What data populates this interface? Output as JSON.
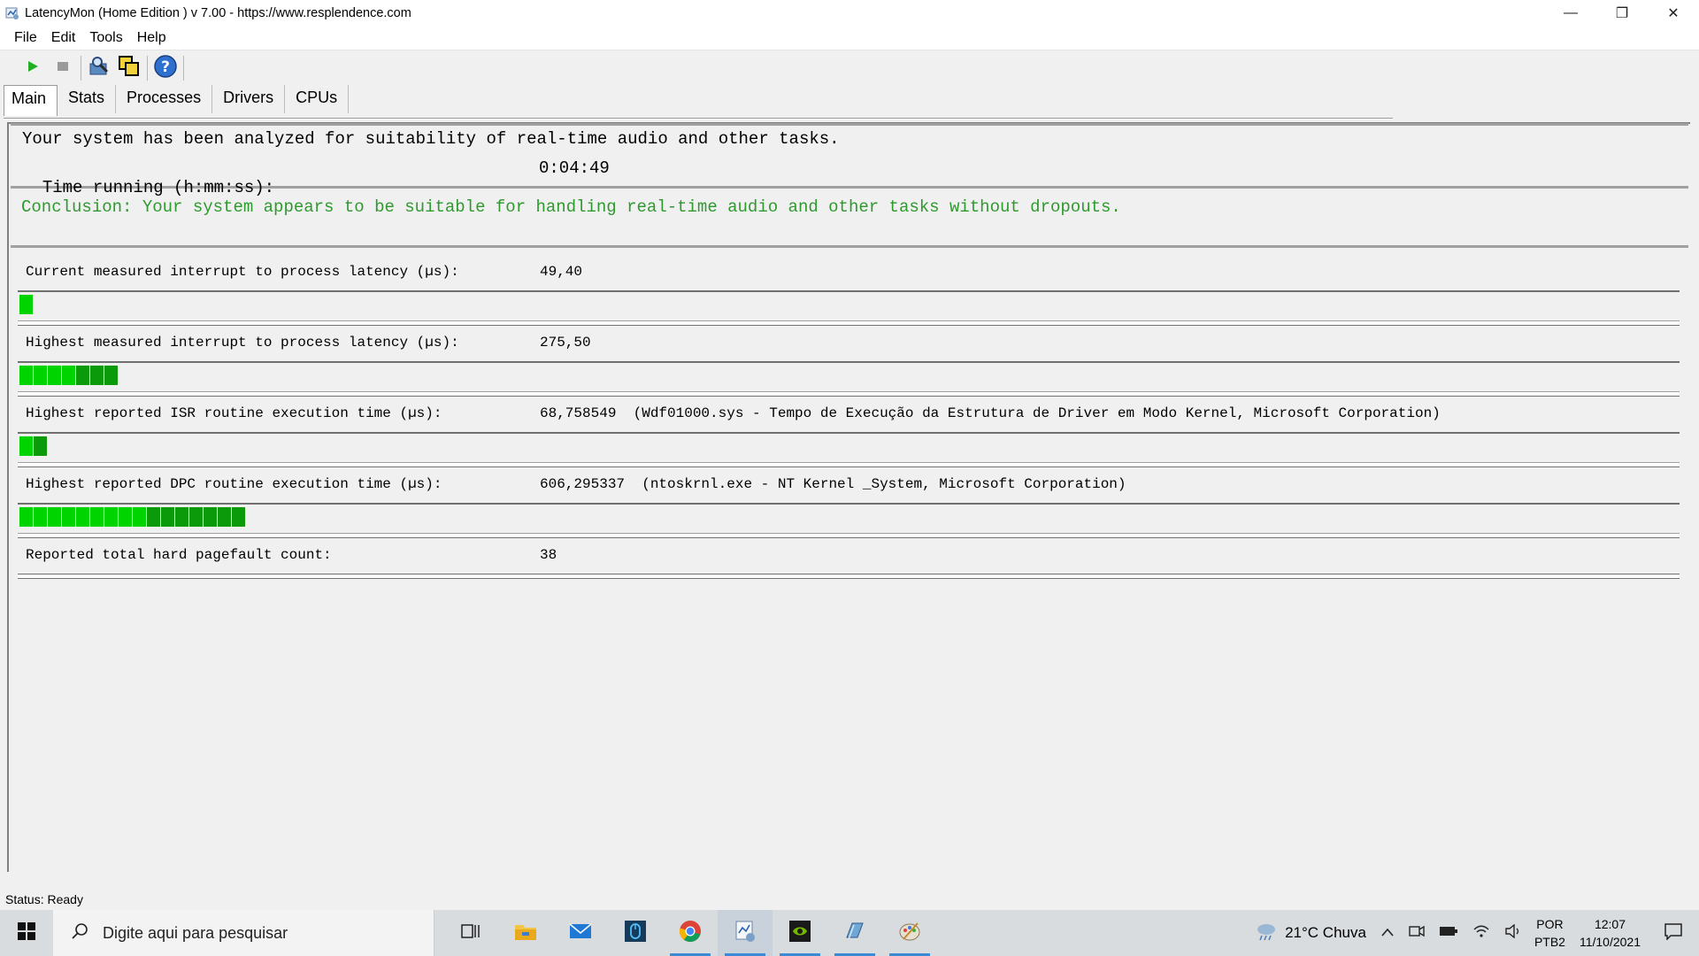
{
  "window": {
    "title": "LatencyMon  (Home Edition )  v 7.00 - https://www.resplendence.com",
    "minimize": "—",
    "restore": "❐",
    "close": "✕"
  },
  "menu": [
    "File",
    "Edit",
    "Tools",
    "Help"
  ],
  "toolbar": {
    "icons": [
      "play-icon",
      "stop-icon",
      "analyze-icon",
      "copy-windows-icon",
      "help-icon"
    ]
  },
  "tabs": [
    "Main",
    "Stats",
    "Processes",
    "Drivers",
    "CPUs"
  ],
  "summary": {
    "analyzed_text": "Your system has been analyzed for suitability of real-time audio and other tasks.",
    "time_label": "Time running (h:mm:ss):",
    "time_value": "0:04:49",
    "conclusion": "Conclusion: Your system appears to be suitable for handling real-time audio and other tasks without dropouts.",
    "conclusion_color": "#2e9a2e"
  },
  "metrics": [
    {
      "label": "Current measured interrupt to process latency (µs):",
      "value": "49,40",
      "bar_segments": 1
    },
    {
      "label": "Highest measured interrupt to process latency (µs):",
      "value": "275,50",
      "bar_segments": 7
    },
    {
      "label": "Highest reported ISR routine execution time (µs):",
      "value": "68,758549  (Wdf01000.sys - Tempo de Execução da Estrutura de Driver em Modo Kernel, Microsoft Corporation)",
      "bar_segments": 2
    },
    {
      "label": "Highest reported DPC routine execution time (µs):",
      "value": "606,295337  (ntoskrnl.exe - NT Kernel _System, Microsoft Corporation)",
      "bar_segments": 16
    },
    {
      "label": "Reported total hard pagefault count:",
      "value": "38",
      "bar_segments": 0
    }
  ],
  "bar_colors": {
    "light": "#00d400",
    "dark": "#0a9a0a"
  },
  "status": "Status: Ready",
  "taskbar": {
    "search_placeholder": "Digite aqui para pesquisar",
    "weather": "21°C  Chuva",
    "lang_top": "POR",
    "lang_bottom": "PTB2",
    "time": "12:07",
    "date": "11/10/2021"
  }
}
